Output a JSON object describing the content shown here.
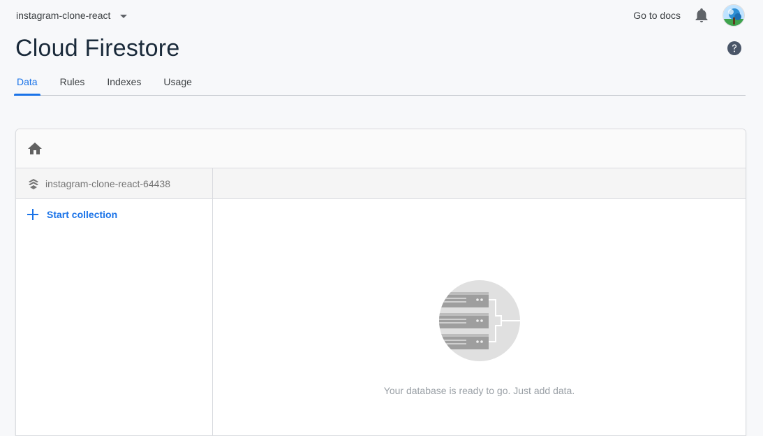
{
  "header": {
    "project_name": "instagram-clone-react",
    "docs_link": "Go to docs"
  },
  "page": {
    "title": "Cloud Firestore"
  },
  "tabs": [
    {
      "label": "Data",
      "active": true
    },
    {
      "label": "Rules",
      "active": false
    },
    {
      "label": "Indexes",
      "active": false
    },
    {
      "label": "Usage",
      "active": false
    }
  ],
  "data_panel": {
    "database_id": "instagram-clone-react-64438",
    "start_collection_label": "Start collection",
    "empty_message": "Your database is ready to go. Just add data."
  },
  "icons": {
    "project_dropdown": "caret-down-icon",
    "notifications": "bell-icon",
    "help": "help-circle-icon",
    "home": "home-icon",
    "database": "firestore-layers-icon",
    "add": "plus-icon",
    "empty_state": "database-servers-illustration"
  },
  "colors": {
    "accent": "#1a73e8",
    "title": "#1a2a3a",
    "background": "#f7f8fa"
  }
}
